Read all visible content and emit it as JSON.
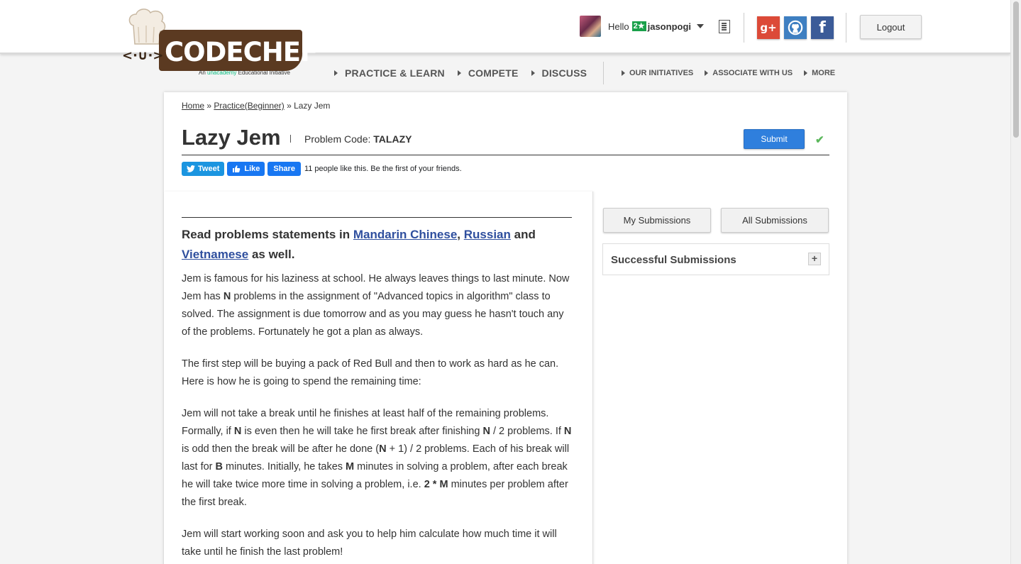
{
  "brand": {
    "logo_text": "CODECHEF",
    "tagline_prefix": "An",
    "tagline_brand": "unacademy",
    "tagline_suffix": "Educational Initiative"
  },
  "user": {
    "greeting": "Hello",
    "rating_badge": "2★",
    "username": "jasonpogi"
  },
  "header": {
    "social": {
      "gplus_label": "g+",
      "facebook_label": "f"
    },
    "logout_label": "Logout"
  },
  "nav": {
    "main": [
      "PRACTICE & LEARN",
      "COMPETE",
      "DISCUSS"
    ],
    "secondary": [
      "OUR INITIATIVES",
      "ASSOCIATE WITH US",
      "MORE"
    ]
  },
  "breadcrumb": {
    "home": "Home",
    "sep1": " » ",
    "practice": "Practice(Beginner)",
    "sep2": " » ",
    "current": "Lazy Jem"
  },
  "problem": {
    "title": "Lazy Jem",
    "code_label": "Problem Code:",
    "code": "TALAZY",
    "submit_label": "Submit",
    "solved_check": "✔"
  },
  "share": {
    "tweet_label": "Tweet",
    "like_label": "Like",
    "share_label": "Share",
    "like_text": "11 people like this. Be the first of your friends."
  },
  "languages": {
    "prefix": "Read problems statements in",
    "mandarin": "Mandarin Chinese",
    "comma": ",",
    "russian": "Russian",
    "and": "and",
    "vietnamese": "Vietnamese",
    "suffix": "as well."
  },
  "statement": {
    "p1_a": "Jem is famous for his laziness at school. He always leaves things to last minute. Now Jem has ",
    "p1_n": "N",
    "p1_b": " problems in the assignment of \"Advanced topics in algorithm\" class to solved. The assignment is due tomorrow and as you may guess he hasn't touch any of the problems. Fortunately he got a plan as always.",
    "p2": "The first step will be buying a pack of Red Bull and then to work as hard as he can. Here is how he is going to spend the remaining time:",
    "p3_a": "Jem will not take a break until he finishes at least half of the remaining problems. Formally, if ",
    "p3_n1": "N",
    "p3_b": " is even then he will take he first break after finishing ",
    "p3_n2": "N",
    "p3_c": " / 2 problems. If ",
    "p3_n3": "N",
    "p3_d": " is odd then the break will be after he done (",
    "p3_n4": "N",
    "p3_e": " + 1) / 2 problems. Each of his break will last for ",
    "p3_b_var": "B",
    "p3_f": " minutes. Initially, he takes ",
    "p3_m": "M",
    "p3_g": " minutes in solving a problem, after each break he will take twice more time in solving a problem, i.e. ",
    "p3_2m": "2 * M",
    "p3_h": " minutes per problem after the first break.",
    "p4": "Jem will start working soon and ask you to help him calculate how much time it will take until he finish the last problem!"
  },
  "sidebar": {
    "my_submissions": "My Submissions",
    "all_submissions": "All Submissions",
    "successful_submissions": "Successful Submissions",
    "expand": "+"
  }
}
